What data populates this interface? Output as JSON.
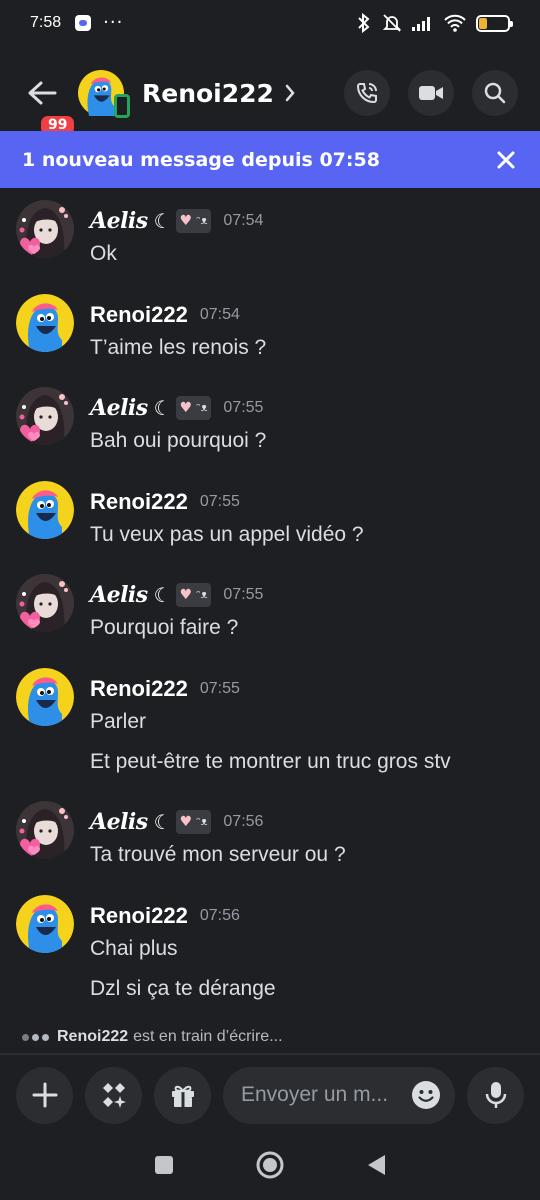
{
  "status_bar": {
    "time": "7:58",
    "battery": "29"
  },
  "header": {
    "back_badge": "99",
    "title": "Renoi222"
  },
  "banner": {
    "text": "1 nouveau message depuis 07:58"
  },
  "messages": [
    {
      "author": "Aelis",
      "avatar": "aelis",
      "time": "07:54",
      "lines": [
        "Ok"
      ]
    },
    {
      "author": "Renoi222",
      "avatar": "renoi",
      "time": "07:54",
      "lines": [
        "T’aime les renois ?"
      ]
    },
    {
      "author": "Aelis",
      "avatar": "aelis",
      "time": "07:55",
      "lines": [
        "Bah oui pourquoi ?"
      ]
    },
    {
      "author": "Renoi222",
      "avatar": "renoi",
      "time": "07:55",
      "lines": [
        "Tu veux pas un appel vidéo ?"
      ]
    },
    {
      "author": "Aelis",
      "avatar": "aelis",
      "time": "07:55",
      "lines": [
        "Pourquoi faire ?"
      ]
    },
    {
      "author": "Renoi222",
      "avatar": "renoi",
      "time": "07:55",
      "lines": [
        "Parler",
        "Et peut-être te montrer un truc gros stv"
      ]
    },
    {
      "author": "Aelis",
      "avatar": "aelis",
      "time": "07:56",
      "lines": [
        "Ta trouvé mon serveur ou ?"
      ]
    },
    {
      "author": "Renoi222",
      "avatar": "renoi",
      "time": "07:56",
      "lines": [
        "Chai plus",
        "Dzl si ça te dérange"
      ]
    }
  ],
  "aelis_suffix": "☾",
  "typing": {
    "user": "Renoi222",
    "text": "est en train d’écrire..."
  },
  "composer": {
    "placeholder": "Envoyer un m..."
  },
  "icons": [
    "back-arrow-icon",
    "phone-icon",
    "video-icon",
    "search-icon",
    "close-icon",
    "plus-icon",
    "apps-icon",
    "gift-icon",
    "emoji-icon",
    "mic-icon"
  ],
  "colors": {
    "background": "#1e1f22",
    "banner": "#5865f2",
    "badge": "#f23f43",
    "timestamp": "#949ba4"
  }
}
